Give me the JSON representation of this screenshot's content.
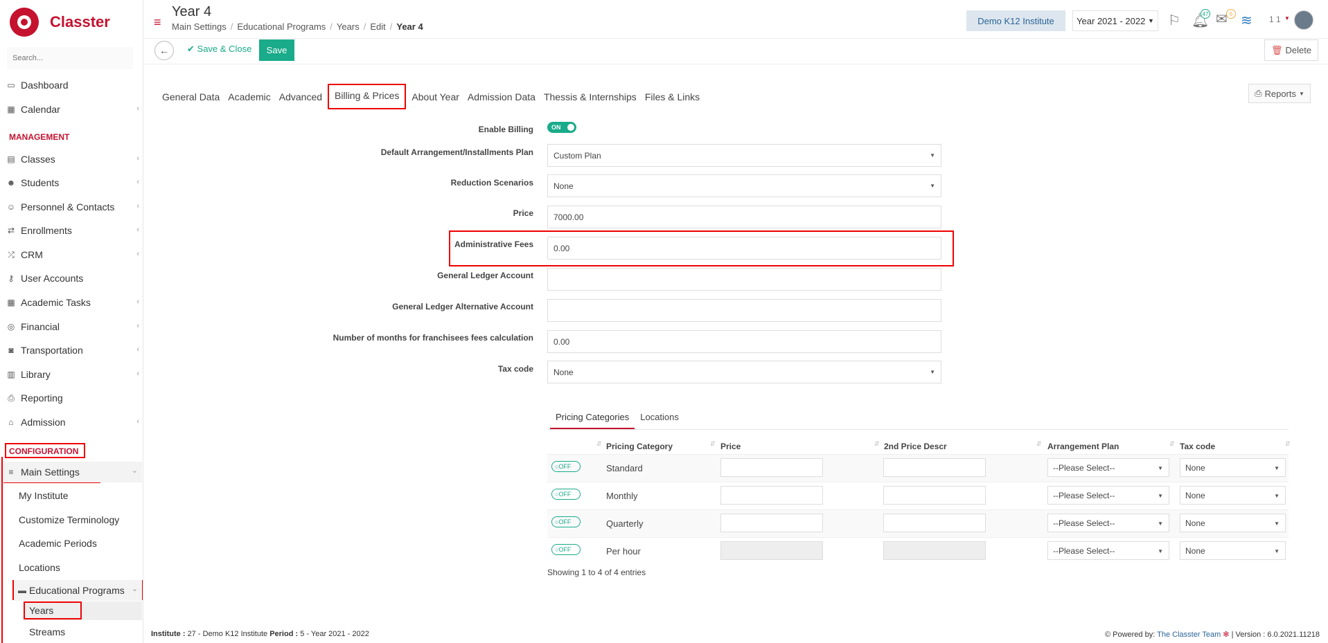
{
  "app": {
    "name": "Classter"
  },
  "sidebar": {
    "search_placeholder": "Search...",
    "items_top": [
      {
        "label": "Dashboard",
        "icon": "laptop-icon"
      },
      {
        "label": "Calendar",
        "icon": "calendar-icon"
      }
    ],
    "management_title": "MANAGEMENT",
    "management_items": [
      {
        "label": "Classes",
        "icon": "classes-icon"
      },
      {
        "label": "Students",
        "icon": "students-icon"
      },
      {
        "label": "Personnel & Contacts",
        "icon": "personnel-icon"
      },
      {
        "label": "Enrollments",
        "icon": "exchange-icon"
      },
      {
        "label": "CRM",
        "icon": "crm-icon"
      },
      {
        "label": "User Accounts",
        "icon": "key-icon"
      },
      {
        "label": "Academic Tasks",
        "icon": "tasks-icon"
      },
      {
        "label": "Financial",
        "icon": "coins-icon"
      },
      {
        "label": "Transportation",
        "icon": "bus-icon"
      },
      {
        "label": "Library",
        "icon": "books-icon"
      },
      {
        "label": "Reporting",
        "icon": "print-icon"
      },
      {
        "label": "Admission",
        "icon": "bank-icon"
      }
    ],
    "configuration_title": "CONFIGURATION",
    "main_settings": "Main Settings",
    "sub_items": [
      "My Institute",
      "Customize Terminology",
      "Academic Periods",
      "Locations"
    ],
    "educational_programs": "Educational Programs",
    "years": "Years",
    "streams": "Streams"
  },
  "header": {
    "title": "Year 4",
    "breadcrumb": [
      "Main Settings",
      "Educational Programs",
      "Years",
      "Edit",
      "Year 4"
    ],
    "institute": "Demo K12 Institute",
    "year_select": "Year 2021 - 2022",
    "notifications_count": "47",
    "messages_count": "6",
    "user_label": "1 1"
  },
  "toolbar": {
    "save_close": "Save & Close",
    "save": "Save",
    "delete": "Delete"
  },
  "tabs": [
    "General Data",
    "Academic",
    "Advanced",
    "Billing & Prices",
    "About Year",
    "Admission Data",
    "Thessis & Internships",
    "Files & Links"
  ],
  "active_tab": "Billing & Prices",
  "reports_label": "Reports",
  "form": {
    "enable_billing": {
      "label": "Enable Billing",
      "value": "ON"
    },
    "default_plan": {
      "label": "Default Arrangement/Installments Plan",
      "value": "Custom Plan"
    },
    "reduction": {
      "label": "Reduction Scenarios",
      "value": "None"
    },
    "price": {
      "label": "Price",
      "value": "7000.00"
    },
    "admin_fees": {
      "label": "Administrative Fees",
      "value": "0.00"
    },
    "gl_account": {
      "label": "General Ledger Account",
      "value": ""
    },
    "gl_alt_account": {
      "label": "General Ledger Alternative Account",
      "value": ""
    },
    "months_franchisees": {
      "label": "Number of months for franchisees fees calculation",
      "value": "0.00"
    },
    "tax_code": {
      "label": "Tax code",
      "value": "None"
    }
  },
  "pricing": {
    "tabs": [
      "Pricing Categories",
      "Locations"
    ],
    "columns": [
      "Pricing Category",
      "Price",
      "2nd Price Descr",
      "Arrangement Plan",
      "Tax code"
    ],
    "rows": [
      {
        "toggle": "OFF",
        "category": "Standard",
        "plan": "--Please Select--",
        "tax": "None"
      },
      {
        "toggle": "OFF",
        "category": "Monthly",
        "plan": "--Please Select--",
        "tax": "None"
      },
      {
        "toggle": "OFF",
        "category": "Quarterly",
        "plan": "--Please Select--",
        "tax": "None"
      },
      {
        "toggle": "OFF",
        "category": "Per hour",
        "plan": "--Please Select--",
        "tax": "None"
      }
    ],
    "showing": "Showing 1 to 4 of 4 entries"
  },
  "footer": {
    "institute_label": "Institute :",
    "institute_value": "27 - Demo K12 Institute",
    "period_label": "Period :",
    "period_value": "5 - Year 2021 - 2022",
    "powered_by": "Powered by:",
    "team": "The Classter Team",
    "version": "| Version : 6.0.2021.11218"
  }
}
